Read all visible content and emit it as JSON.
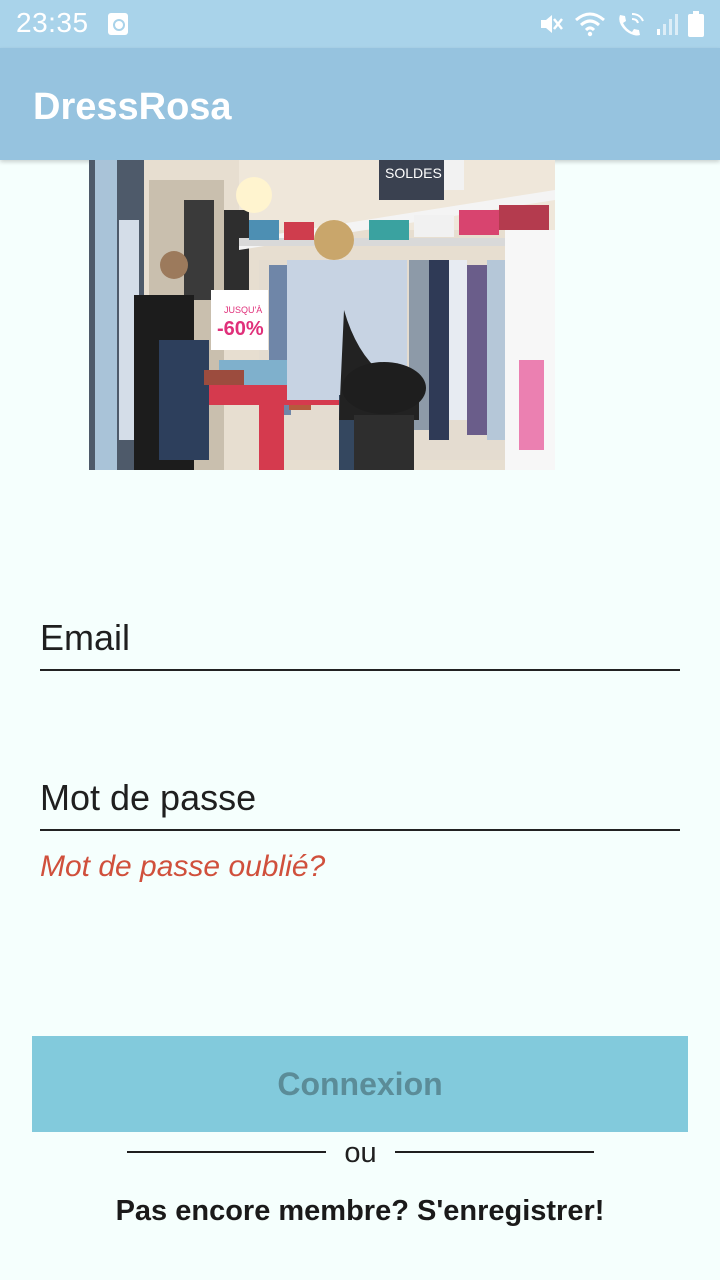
{
  "status_bar": {
    "time": "23:35",
    "icons": [
      "app-notification-icon",
      "mute-icon",
      "wifi-icon",
      "wifi-calling-icon",
      "signal-icon",
      "battery-icon"
    ]
  },
  "app_bar": {
    "title": "DressRosa"
  },
  "hero_image": {
    "sign_text": "-60%",
    "sign_small": "JUSQU'À",
    "shelf_sign": "SOLDES"
  },
  "form": {
    "email_placeholder": "Email",
    "password_placeholder": "Mot de passe",
    "forgot_password": "Mot de passe oublié?",
    "login_button": "Connexion",
    "divider_text": "ou",
    "register_link": "Pas encore membre? S'enregistrer!"
  },
  "colors": {
    "status_bar": "#a9d3ea",
    "app_bar": "#96c3df",
    "background": "#f5fffd",
    "accent_link": "#d0503c",
    "button": "#82cadc",
    "button_text": "#5b8c98"
  }
}
